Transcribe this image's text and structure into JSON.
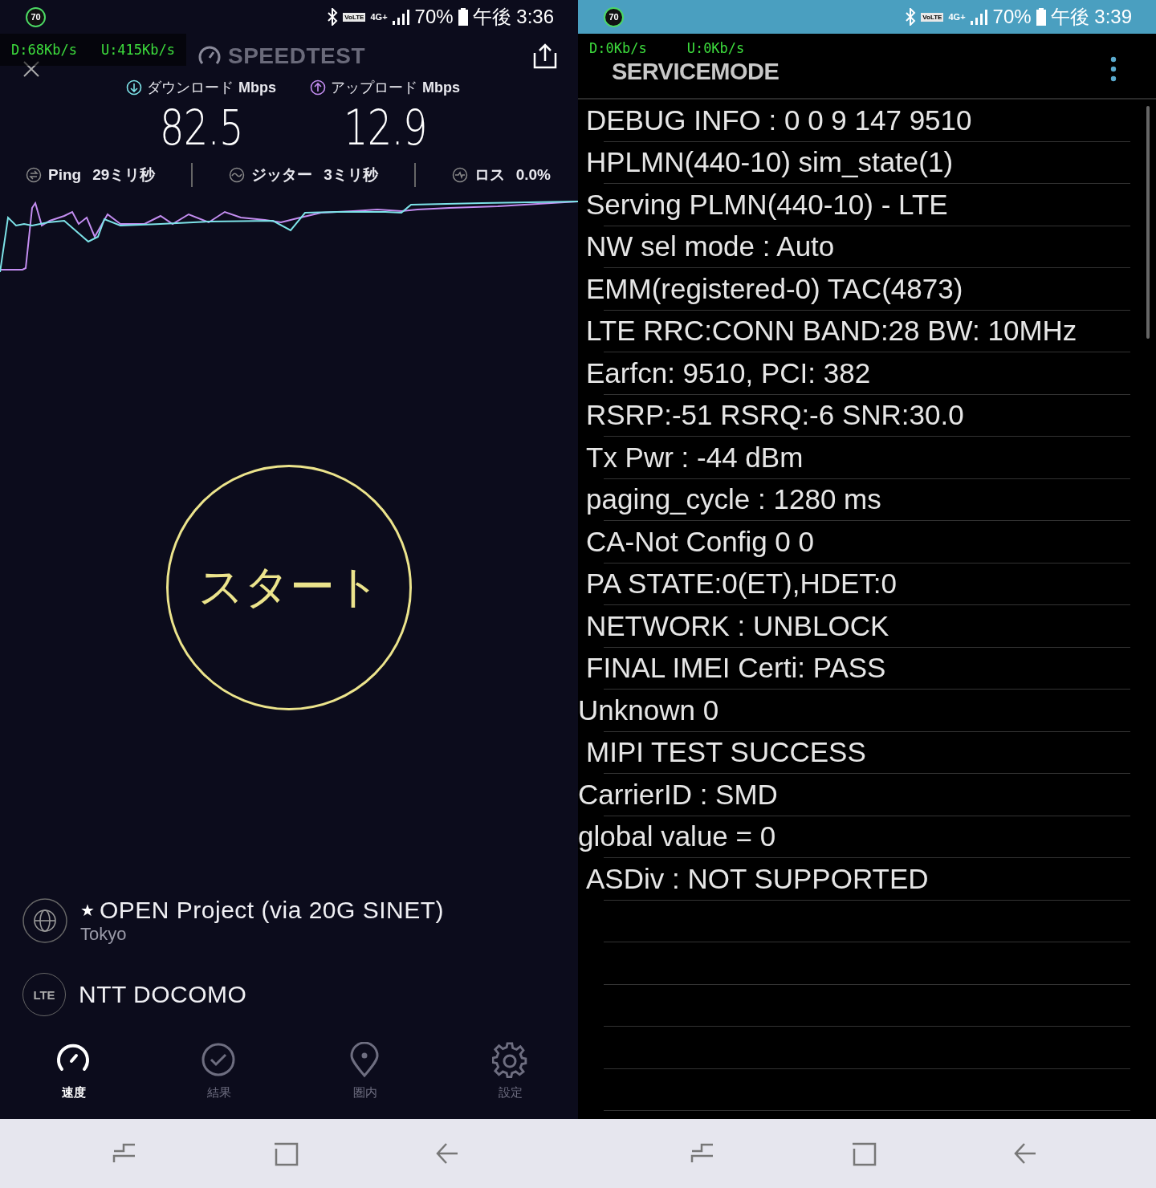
{
  "left_screen": {
    "status_bar": {
      "badge": "70",
      "volte": "VoLTE",
      "network": "4G+",
      "battery": "70%",
      "time": "午後 3:36"
    },
    "speed_overlay": {
      "download": "D:68Kb/s",
      "upload": "U:415Kb/s"
    },
    "app_title": "SPEEDTEST",
    "results": [
      {
        "kind": "download",
        "label": "ダウンロード",
        "unit": "Mbps",
        "value": "82.5"
      },
      {
        "kind": "upload",
        "label": "アップロード",
        "unit": "Mbps",
        "value": "12.9"
      }
    ],
    "stats": [
      {
        "kind": "ping",
        "label": "Ping",
        "value": "29ミリ秒"
      },
      {
        "kind": "jitter",
        "label": "ジッター",
        "value": "3ミリ秒"
      },
      {
        "kind": "loss",
        "label": "ロス",
        "value": "0.0%"
      }
    ],
    "start_button": "スタート",
    "server": {
      "star": "★",
      "name": "OPEN Project (via 20G SINET)",
      "location": "Tokyo"
    },
    "carrier": {
      "badge": "LTE",
      "name": "NTT DOCOMO"
    },
    "tabs": [
      {
        "kind": "speed",
        "label": "速度",
        "selected": true
      },
      {
        "kind": "results",
        "label": "結果",
        "selected": false
      },
      {
        "kind": "coverage",
        "label": "圏内",
        "selected": false
      },
      {
        "kind": "settings",
        "label": "設定",
        "selected": false
      }
    ]
  },
  "right_screen": {
    "status_bar": {
      "badge": "70",
      "volte": "VoLTE",
      "network": "4G+",
      "battery": "70%",
      "time": "午後 3:39"
    },
    "speed_overlay": {
      "download": "D:0Kb/s",
      "upload": "U:0Kb/s"
    },
    "title": "SERVICEMODE",
    "lines": [
      {
        "text": "DEBUG INFO : 0 0 9 147 9510",
        "indented": true
      },
      {
        "text": "HPLMN(440-10) sim_state(1)",
        "indented": true
      },
      {
        "text": "Serving PLMN(440-10) - LTE",
        "indented": true
      },
      {
        "text": "NW sel mode : Auto",
        "indented": true
      },
      {
        "text": "EMM(registered-0) TAC(4873)",
        "indented": true
      },
      {
        "text": "LTE RRC:CONN BAND:28 BW: 10MHz",
        "indented": true
      },
      {
        "text": "Earfcn: 9510, PCI: 382",
        "indented": true
      },
      {
        "text": "RSRP:-51 RSRQ:-6 SNR:30.0",
        "indented": true
      },
      {
        "text": "Tx Pwr : -44 dBm",
        "indented": true
      },
      {
        "text": "paging_cycle : 1280 ms",
        "indented": true
      },
      {
        "text": "CA-Not Config 0 0",
        "indented": true
      },
      {
        "text": "PA STATE:0(ET),HDET:0",
        "indented": true
      },
      {
        "text": "NETWORK : UNBLOCK",
        "indented": true
      },
      {
        "text": "FINAL IMEI Certi: PASS",
        "indented": true
      },
      {
        "text": "Unknown 0",
        "indented": false
      },
      {
        "text": "MIPI TEST SUCCESS",
        "indented": true
      },
      {
        "text": "CarrierID : SMD",
        "indented": false
      },
      {
        "text": "global value = 0",
        "indented": false
      },
      {
        "text": "ASDiv : NOT SUPPORTED",
        "indented": true
      }
    ]
  }
}
